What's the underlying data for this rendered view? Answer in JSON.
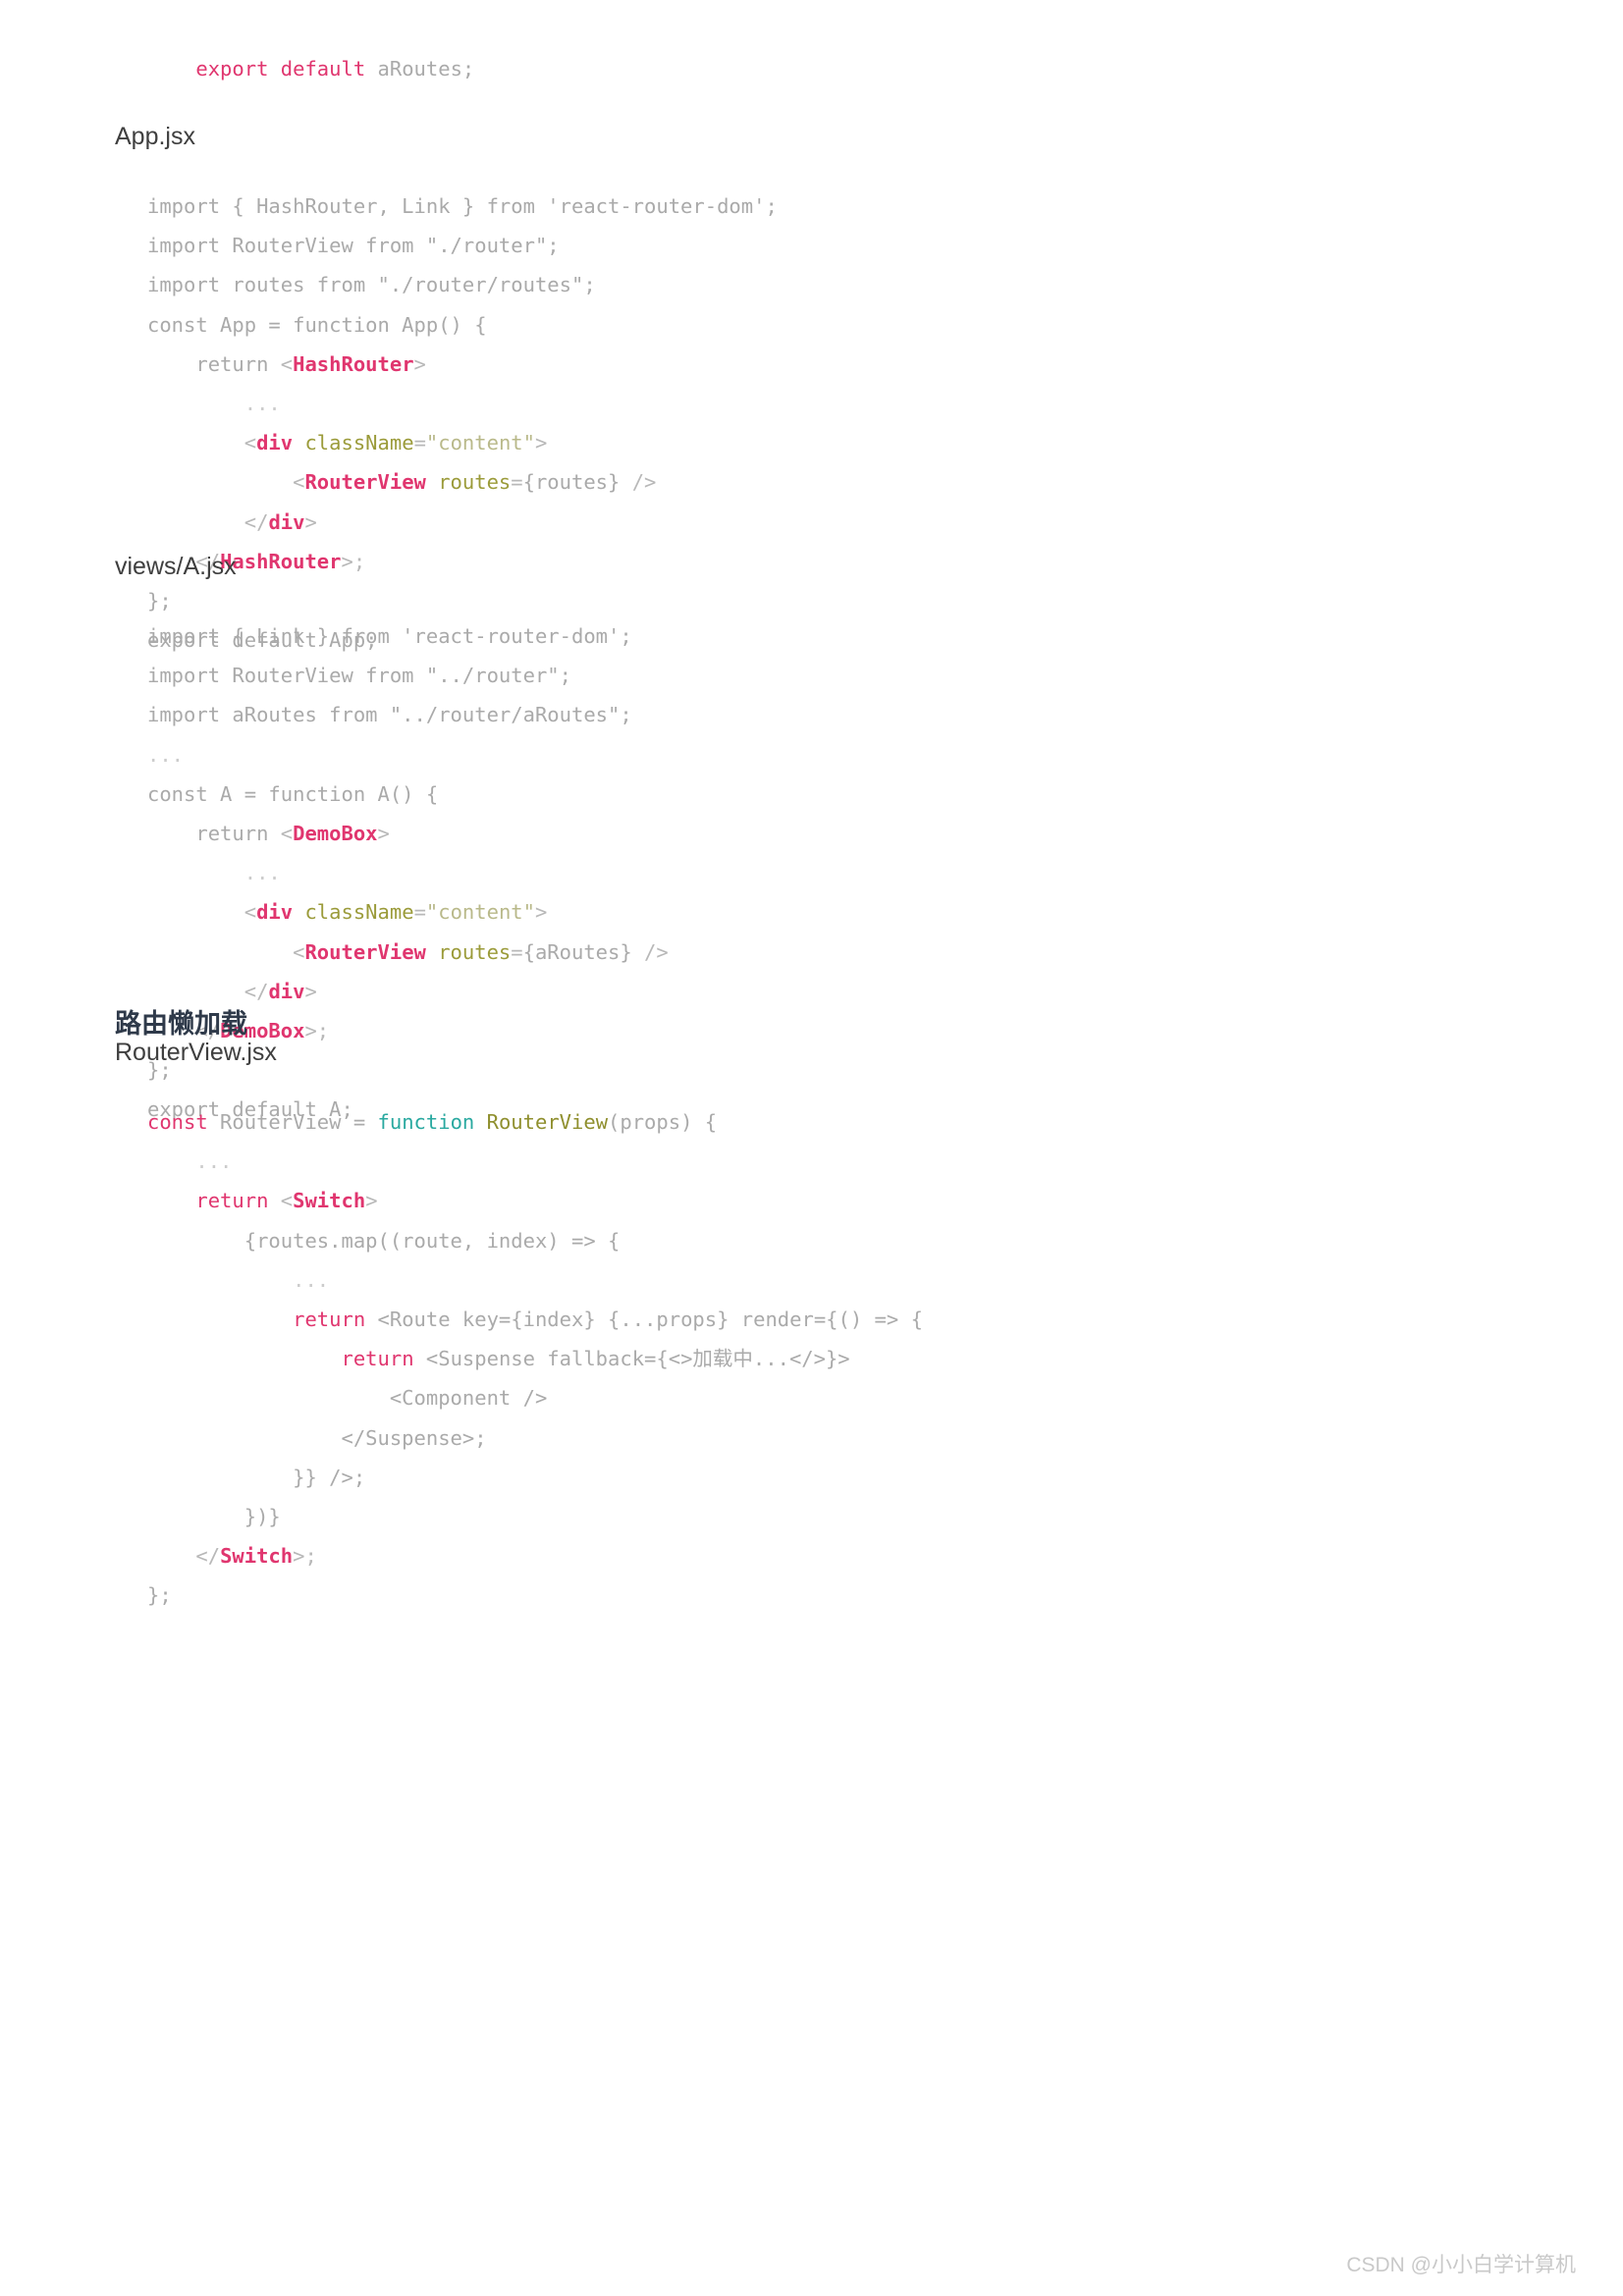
{
  "document": {
    "watermark": "CSDN @小小白学计算机"
  },
  "blocks": {
    "top_code": {
      "lines": [
        [
          {
            "text": "    ",
            "cls": "t-plain"
          },
          {
            "text": "export default",
            "cls": "t-keyword"
          },
          {
            "text": " aRoutes;",
            "cls": "t-plain"
          }
        ]
      ]
    },
    "app_caption": "App.jsx",
    "app_code": {
      "lines": [
        [
          {
            "text": "import { HashRouter, Link } from 'react-router-dom';",
            "cls": "t-plain"
          }
        ],
        [
          {
            "text": "import RouterView from \"./router\";",
            "cls": "t-plain"
          }
        ],
        [
          {
            "text": "import routes from \"./router/routes\";",
            "cls": "t-plain"
          }
        ],
        [
          {
            "text": "const App = function App() {",
            "cls": "t-plain"
          }
        ],
        [
          {
            "text": "    return ",
            "cls": "t-plain"
          },
          {
            "text": "<",
            "cls": "t-tagpunct"
          },
          {
            "text": "HashRouter",
            "cls": "t-tag"
          },
          {
            "text": ">",
            "cls": "t-tagpunct"
          }
        ],
        [
          {
            "text": "        ...",
            "cls": "t-dots"
          }
        ],
        [
          {
            "text": "        ",
            "cls": "t-plain"
          },
          {
            "text": "<",
            "cls": "t-tagpunct"
          },
          {
            "text": "div",
            "cls": "t-tag"
          },
          {
            "text": " ",
            "cls": "t-plain"
          },
          {
            "text": "className",
            "cls": "t-attr"
          },
          {
            "text": "=",
            "cls": "t-tagpunct"
          },
          {
            "text": "\"content\"",
            "cls": "t-string"
          },
          {
            "text": ">",
            "cls": "t-tagpunct"
          }
        ],
        [
          {
            "text": "            ",
            "cls": "t-plain"
          },
          {
            "text": "<",
            "cls": "t-tagpunct"
          },
          {
            "text": "RouterView",
            "cls": "t-tag"
          },
          {
            "text": " ",
            "cls": "t-plain"
          },
          {
            "text": "routes",
            "cls": "t-attr"
          },
          {
            "text": "=",
            "cls": "t-tagpunct"
          },
          {
            "text": "{routes}",
            "cls": "t-plain"
          },
          {
            "text": " />",
            "cls": "t-tagpunct"
          }
        ],
        [
          {
            "text": "        ",
            "cls": "t-plain"
          },
          {
            "text": "</",
            "cls": "t-tagpunct"
          },
          {
            "text": "div",
            "cls": "t-tag"
          },
          {
            "text": ">",
            "cls": "t-tagpunct"
          }
        ],
        [
          {
            "text": "    ",
            "cls": "t-plain"
          },
          {
            "text": "</",
            "cls": "t-tagpunct"
          },
          {
            "text": "HashRouter",
            "cls": "t-tag"
          },
          {
            "text": ">;",
            "cls": "t-tagpunct"
          }
        ],
        [
          {
            "text": "};",
            "cls": "t-plain"
          }
        ],
        [
          {
            "text": "export default App;",
            "cls": "t-plain"
          }
        ]
      ]
    },
    "a_caption": "views/A.jsx",
    "a_code": {
      "lines": [
        [
          {
            "text": "import { Link } from 'react-router-dom';",
            "cls": "t-plain"
          }
        ],
        [
          {
            "text": "import RouterView from \"../router\";",
            "cls": "t-plain"
          }
        ],
        [
          {
            "text": "import aRoutes from \"../router/aRoutes\";",
            "cls": "t-plain"
          }
        ],
        [
          {
            "text": "...",
            "cls": "t-dots"
          }
        ],
        [
          {
            "text": "const A = function A() {",
            "cls": "t-plain"
          }
        ],
        [
          {
            "text": "    return ",
            "cls": "t-plain"
          },
          {
            "text": "<",
            "cls": "t-tagpunct"
          },
          {
            "text": "DemoBox",
            "cls": "t-tag"
          },
          {
            "text": ">",
            "cls": "t-tagpunct"
          }
        ],
        [
          {
            "text": "        ...",
            "cls": "t-dots"
          }
        ],
        [
          {
            "text": "        ",
            "cls": "t-plain"
          },
          {
            "text": "<",
            "cls": "t-tagpunct"
          },
          {
            "text": "div",
            "cls": "t-tag"
          },
          {
            "text": " ",
            "cls": "t-plain"
          },
          {
            "text": "className",
            "cls": "t-attr"
          },
          {
            "text": "=",
            "cls": "t-tagpunct"
          },
          {
            "text": "\"content\"",
            "cls": "t-string"
          },
          {
            "text": ">",
            "cls": "t-tagpunct"
          }
        ],
        [
          {
            "text": "            ",
            "cls": "t-plain"
          },
          {
            "text": "<",
            "cls": "t-tagpunct"
          },
          {
            "text": "RouterView",
            "cls": "t-tag"
          },
          {
            "text": " ",
            "cls": "t-plain"
          },
          {
            "text": "routes",
            "cls": "t-attr"
          },
          {
            "text": "=",
            "cls": "t-tagpunct"
          },
          {
            "text": "{aRoutes}",
            "cls": "t-plain"
          },
          {
            "text": " />",
            "cls": "t-tagpunct"
          }
        ],
        [
          {
            "text": "        ",
            "cls": "t-plain"
          },
          {
            "text": "</",
            "cls": "t-tagpunct"
          },
          {
            "text": "div",
            "cls": "t-tag"
          },
          {
            "text": ">",
            "cls": "t-tagpunct"
          }
        ],
        [
          {
            "text": "    ",
            "cls": "t-plain"
          },
          {
            "text": "</",
            "cls": "t-tagpunct"
          },
          {
            "text": "DemoBox",
            "cls": "t-tag"
          },
          {
            "text": ">;",
            "cls": "t-tagpunct"
          }
        ],
        [
          {
            "text": "};",
            "cls": "t-plain"
          }
        ],
        [
          {
            "text": "export default A;",
            "cls": "t-plain"
          }
        ]
      ]
    },
    "lazy_heading": "路由懒加载",
    "routerview_caption": "RouterView.jsx",
    "routerview_code": {
      "lines": [
        [
          {
            "text": "const",
            "cls": "t-keyword"
          },
          {
            "text": " RouterView = ",
            "cls": "t-plain"
          },
          {
            "text": "function",
            "cls": "t-func"
          },
          {
            "text": " ",
            "cls": "t-plain"
          },
          {
            "text": "RouterView",
            "cls": "t-fname"
          },
          {
            "text": "(props) {",
            "cls": "t-plain"
          }
        ],
        [
          {
            "text": "    ...",
            "cls": "t-dots"
          }
        ],
        [
          {
            "text": "    ",
            "cls": "t-plain"
          },
          {
            "text": "return",
            "cls": "t-keyword"
          },
          {
            "text": " ",
            "cls": "t-plain"
          },
          {
            "text": "<",
            "cls": "t-tagpunct"
          },
          {
            "text": "Switch",
            "cls": "t-tag"
          },
          {
            "text": ">",
            "cls": "t-tagpunct"
          }
        ],
        [
          {
            "text": "        {routes.map((route, index) => {",
            "cls": "t-plain"
          }
        ],
        [
          {
            "text": "            ...",
            "cls": "t-dots"
          }
        ],
        [
          {
            "text": "            ",
            "cls": "t-plain"
          },
          {
            "text": "return",
            "cls": "t-keyword"
          },
          {
            "text": " <Route key={index} {...props} render={() => {",
            "cls": "t-plain"
          }
        ],
        [
          {
            "text": "                ",
            "cls": "t-plain"
          },
          {
            "text": "return",
            "cls": "t-keyword"
          },
          {
            "text": " <Suspense fallback={<>加载中...</>}>",
            "cls": "t-plain"
          }
        ],
        [
          {
            "text": "                    <Component />",
            "cls": "t-plain"
          }
        ],
        [
          {
            "text": "                </Suspense>;",
            "cls": "t-plain"
          }
        ],
        [
          {
            "text": "            }} />;",
            "cls": "t-plain"
          }
        ],
        [
          {
            "text": "        })}",
            "cls": "t-plain"
          }
        ],
        [
          {
            "text": "    ",
            "cls": "t-plain"
          },
          {
            "text": "</",
            "cls": "t-tagpunct"
          },
          {
            "text": "Switch",
            "cls": "t-tag"
          },
          {
            "text": ">;",
            "cls": "t-tagpunct"
          }
        ],
        [
          {
            "text": "};",
            "cls": "t-plain"
          }
        ]
      ]
    }
  }
}
